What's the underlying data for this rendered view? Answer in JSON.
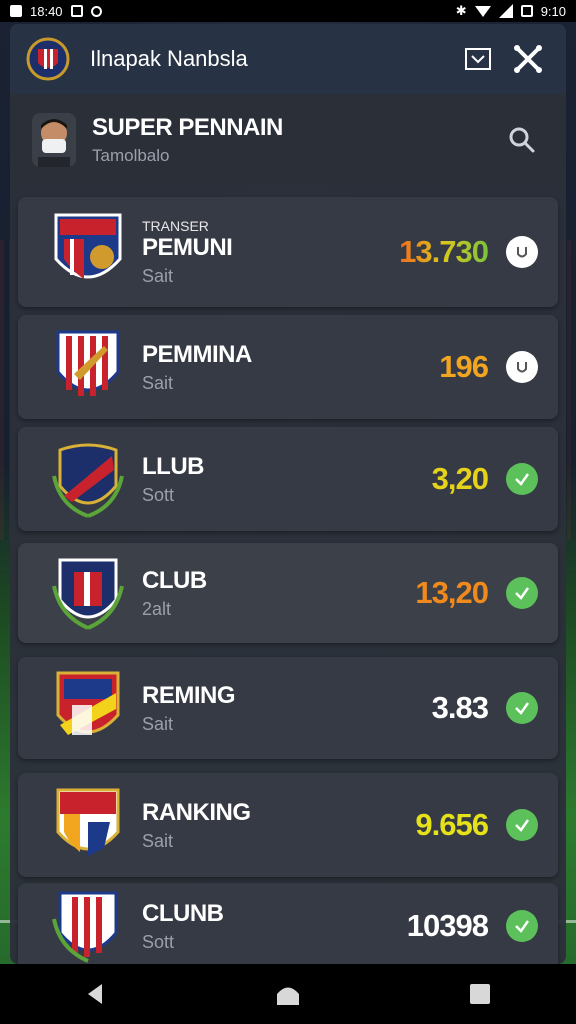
{
  "statusbar": {
    "time": "18:40",
    "right_time": "9:10"
  },
  "header": {
    "title": "Ilnapak Nanbsla"
  },
  "profile": {
    "name": "SUPER PENNAIN",
    "subtitle": "Tamolbalo"
  },
  "rows": [
    {
      "kicker": "TRANSER",
      "title": "PEMUNI",
      "sub": "Sait",
      "value": "13.730",
      "value_color": "gradient-orange-green",
      "status": "pending"
    },
    {
      "kicker": "",
      "title": "PEMMINA",
      "sub": "Sait",
      "value": "196",
      "value_color": "#f2a51f",
      "status": "pending"
    },
    {
      "kicker": "",
      "title": "LLUB",
      "sub": "Sott",
      "value": "3,20",
      "value_color": "#e6d21a",
      "status": "done"
    },
    {
      "kicker": "",
      "title": "CLUB",
      "sub": "2alt",
      "value": "13,20",
      "value_color": "#f08a1c",
      "status": "done"
    },
    {
      "kicker": "",
      "title": "REMING",
      "sub": "Sait",
      "value": "3.83",
      "value_color": "#ffffff",
      "status": "done"
    },
    {
      "kicker": "",
      "title": "RANKING",
      "sub": "Sait",
      "value": "9.656",
      "value_color": "#e6e21a",
      "status": "done"
    },
    {
      "kicker": "",
      "title": "CLUNB",
      "sub": "Sott",
      "value": "10398",
      "value_color": "#ffffff",
      "status": "done"
    }
  ],
  "icons": {
    "header_logo": "club-crest-icon",
    "dropdown": "dropdown-box-icon",
    "close": "close-icon",
    "search": "search-icon",
    "pending": "pending-icon",
    "done": "check-icon"
  }
}
